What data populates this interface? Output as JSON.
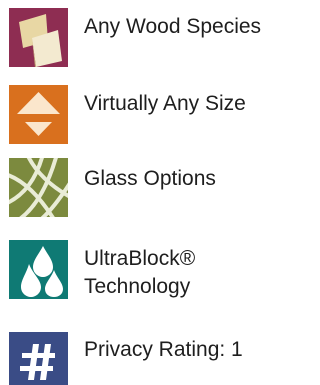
{
  "features": [
    {
      "icon": "wood-species-icon",
      "color": "#8e2d52",
      "label": "Any Wood Species"
    },
    {
      "icon": "size-arrows-icon",
      "color": "#d9701e",
      "label": "Virtually Any Size"
    },
    {
      "icon": "glass-pattern-icon",
      "color": "#7c8a3e",
      "label": "Glass Options"
    },
    {
      "icon": "water-drops-icon",
      "color": "#0f7a74",
      "label_line1": "UltraBlock®",
      "label_line2": "Technology"
    },
    {
      "icon": "hash-privacy-icon",
      "color": "#3a4c86",
      "label": "Privacy Rating: 1"
    }
  ]
}
